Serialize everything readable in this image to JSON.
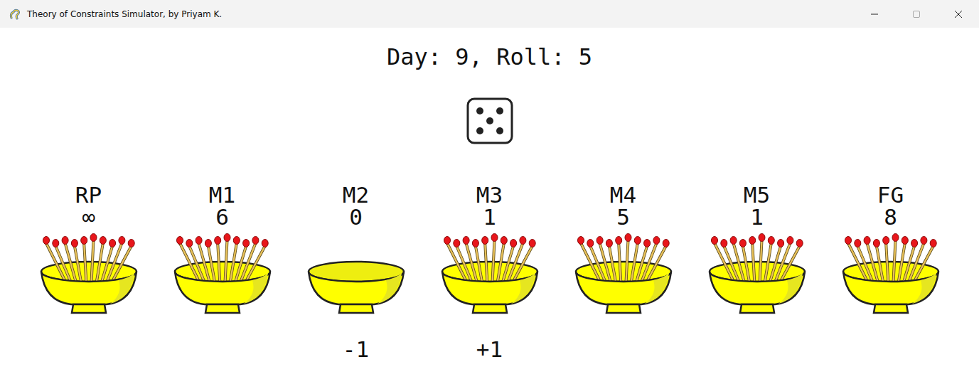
{
  "window": {
    "title": "Theory of Constraints Simulator, by Priyam K."
  },
  "header": "Day: 9, Roll: 5",
  "die": {
    "value": 5
  },
  "bowls": [
    {
      "label": "RP",
      "count": "∞",
      "filled": true,
      "change": ""
    },
    {
      "label": "M1",
      "count": "6",
      "filled": true,
      "change": ""
    },
    {
      "label": "M2",
      "count": "0",
      "filled": false,
      "change": "-1"
    },
    {
      "label": "M3",
      "count": "1",
      "filled": true,
      "change": "+1"
    },
    {
      "label": "M4",
      "count": "5",
      "filled": true,
      "change": ""
    },
    {
      "label": "M5",
      "count": "1",
      "filled": true,
      "change": ""
    },
    {
      "label": "FG",
      "count": "8",
      "filled": true,
      "change": ""
    }
  ]
}
